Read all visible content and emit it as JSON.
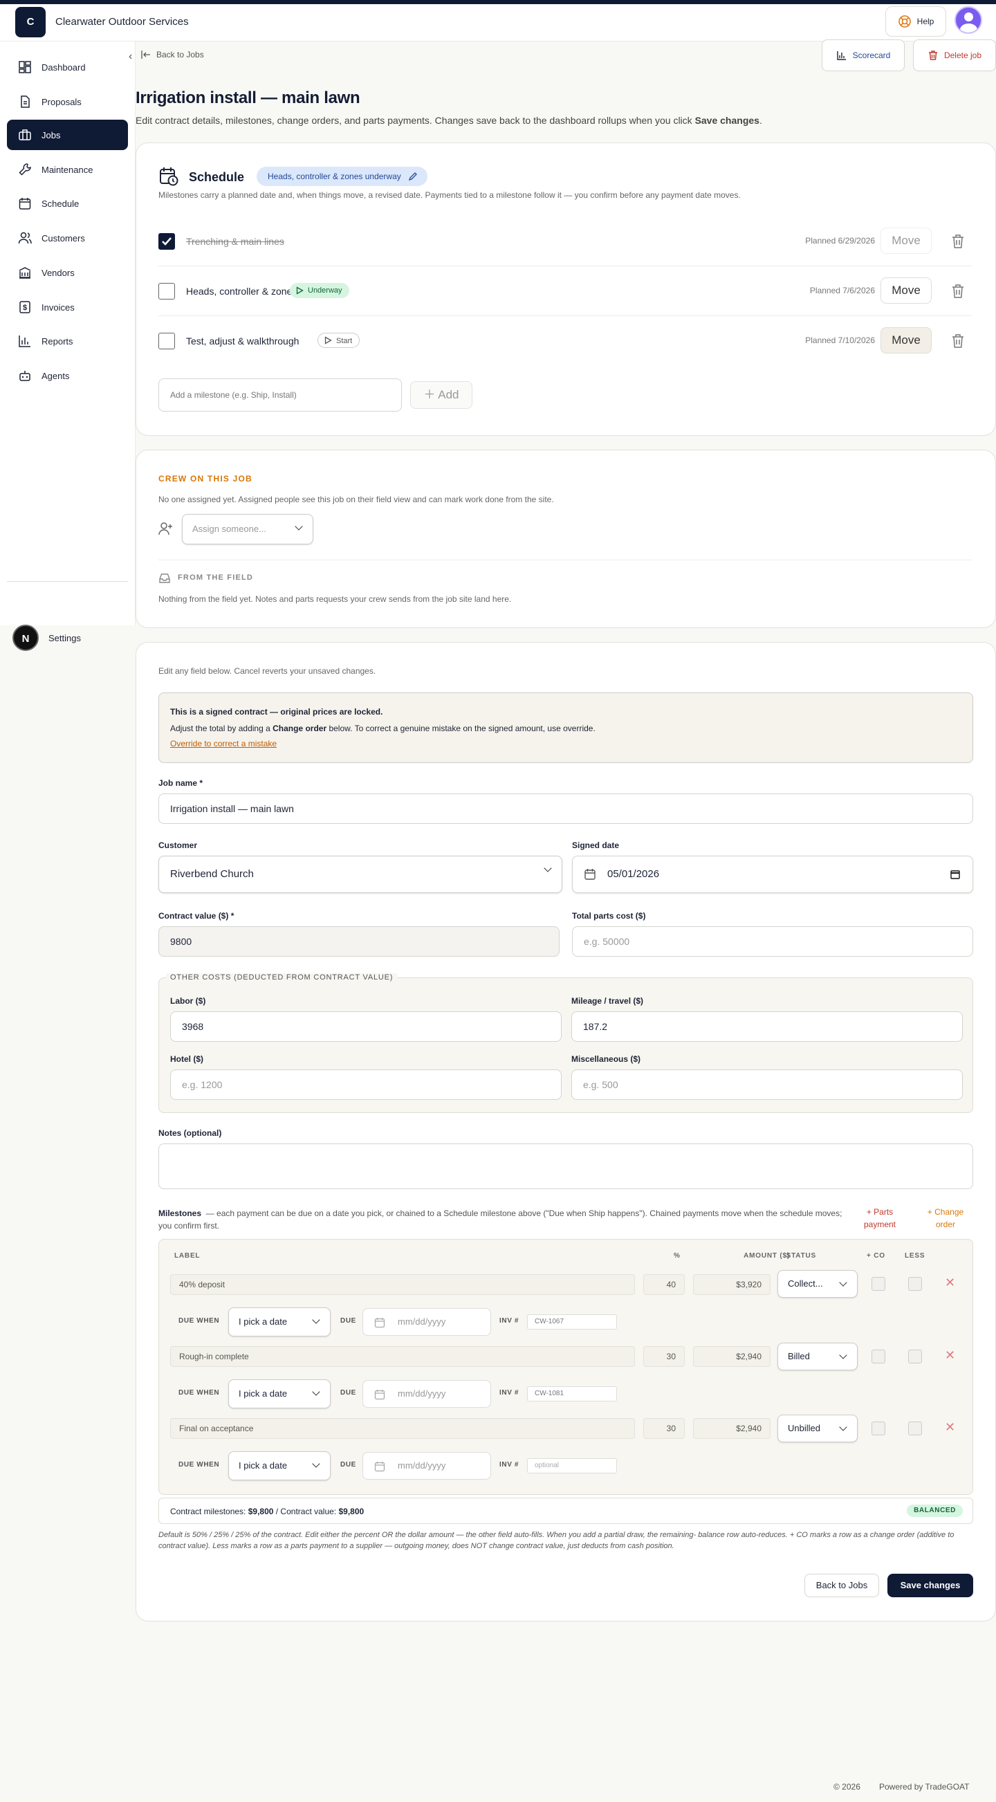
{
  "app": {
    "logo_letter": "C",
    "name": "Clearwater Outdoor Services",
    "help_label": "Help"
  },
  "sidebar": {
    "items": [
      {
        "label": "Dashboard",
        "icon": "dashboard-icon"
      },
      {
        "label": "Proposals",
        "icon": "document-icon"
      },
      {
        "label": "Jobs",
        "icon": "briefcase-icon",
        "active": true
      },
      {
        "label": "Maintenance",
        "icon": "wrench-icon"
      },
      {
        "label": "Schedule",
        "icon": "calendar-icon"
      },
      {
        "label": "Customers",
        "icon": "users-icon"
      },
      {
        "label": "Vendors",
        "icon": "building-icon"
      },
      {
        "label": "Invoices",
        "icon": "dollar-icon"
      },
      {
        "label": "Reports",
        "icon": "bar-chart-icon"
      },
      {
        "label": "Agents",
        "icon": "bot-icon"
      }
    ],
    "settings_label": "Settings",
    "user_initial": "N"
  },
  "header": {
    "back_label": "Back to Jobs",
    "scorecard_label": "Scorecard",
    "delete_label": "Delete job",
    "title": "Irrigation install — main lawn",
    "subtitle_prefix": "Edit contract details, milestones, change orders, and parts payments. Changes save back to the dashboard rollups when you click ",
    "subtitle_bold": "Save changes",
    "subtitle_suffix": "."
  },
  "schedule": {
    "title": "Schedule",
    "status_pill": "Heads, controller & zones underway",
    "description": "Milestones carry a planned date and, when things move, a revised date. Payments tied to a milestone follow it — you confirm before any payment date moves.",
    "milestones": [
      {
        "label": "Trenching & main lines",
        "done": true,
        "status": "",
        "planned": "Planned 6/29/2026",
        "move": "Move"
      },
      {
        "label": "Heads, controller & zones",
        "done": false,
        "status": "Underway",
        "planned": "Planned 7/6/2026",
        "move": "Move"
      },
      {
        "label": "Test, adjust & walkthrough",
        "done": false,
        "status": "Start",
        "planned": "Planned 7/10/2026",
        "move": "Move"
      }
    ],
    "add_placeholder": "Add a milestone (e.g. Ship, Install)",
    "add_label": "Add"
  },
  "crew": {
    "heading": "CREW ON THIS JOB",
    "description": "No one assigned yet. Assigned people see this job on their field view and can mark work done from the site.",
    "assign_placeholder": "Assign someone...",
    "field_heading": "FROM THE FIELD",
    "field_description": "Nothing from the field yet. Notes and parts requests your crew sends from the job site land here."
  },
  "form": {
    "intro": "Edit any field below. Cancel reverts your unsaved changes.",
    "notice_title": "This is a signed contract — original prices are locked.",
    "notice_text_a": "Adjust the total by adding a ",
    "notice_text_bold": "Change order",
    "notice_text_b": " below. To correct a genuine mistake on the signed amount, use override.",
    "notice_link": "Override to correct a mistake",
    "job_name_label": "Job name *",
    "job_name": "Irrigation install — main lawn",
    "customer_label": "Customer",
    "customer": "Riverbend Church",
    "signed_label": "Signed date",
    "signed_date": "05/01/2026",
    "contract_label": "Contract value ($) *",
    "contract_value": "9800",
    "parts_label": "Total parts cost ($)",
    "parts_placeholder": "e.g. 50000",
    "other_costs_legend": "OTHER COSTS (DEDUCTED FROM CONTRACT VALUE)",
    "labor_label": "Labor ($)",
    "labor": "3968",
    "mileage_label": "Mileage / travel ($)",
    "mileage": "187.2",
    "hotel_label": "Hotel ($)",
    "hotel_placeholder": "e.g. 1200",
    "misc_label": "Miscellaneous ($)",
    "misc_placeholder": "e.g. 500",
    "notes_label": "Notes (optional)"
  },
  "payments": {
    "title": "Milestones",
    "description": "— each payment can be due on a date you pick, or chained to a Schedule milestone above (\"Due when Ship happens\"). Chained payments move when the schedule moves; you confirm first.",
    "add_parts": "+ Parts payment",
    "add_co": "+ Change order",
    "headers": {
      "label": "LABEL",
      "pct": "%",
      "amount": "AMOUNT ($)",
      "status": "STATUS",
      "co": "+ CO",
      "less": "LESS"
    },
    "due_when_label": "DUE WHEN",
    "due_label": "DUE",
    "inv_label": "INV #",
    "rows": [
      {
        "label": "40% deposit",
        "pct": "40",
        "amount": "$3,920",
        "status": "Collect...",
        "due_when": "I pick a date",
        "due_placeholder": "mm/dd/yyyy",
        "inv": "CW-1067"
      },
      {
        "label": "Rough-in complete",
        "pct": "30",
        "amount": "$2,940",
        "status": "Billed",
        "due_when": "I pick a date",
        "due_placeholder": "mm/dd/yyyy",
        "inv": "CW-1081"
      },
      {
        "label": "Final on acceptance",
        "pct": "30",
        "amount": "$2,940",
        "status": "Unbilled",
        "due_when": "I pick a date",
        "due_placeholder": "mm/dd/yyyy",
        "inv": "optional"
      }
    ],
    "summary_a": "Contract milestones: ",
    "summary_milestones": "$9,800",
    "summary_b": " / Contract value: ",
    "summary_contract": "$9,800",
    "balanced": "BALANCED",
    "help_text": "Default is 50% / 25% / 25% of the contract. Edit either the percent OR the dollar amount — the other field auto-fills. When you add a partial draw, the remaining- balance row auto-reduces. + CO marks a row as a change order (additive to contract value). Less marks a row as a parts payment to a supplier — outgoing money, does NOT change contract value, just deducts from cash position."
  },
  "actions": {
    "back_label": "Back to Jobs",
    "save_label": "Save changes"
  },
  "footer": {
    "copyright": "© 2026",
    "powered": "Powered by TradeGOAT"
  },
  "colors": {
    "navy": "#0f1a35",
    "accent_orange": "#d97706",
    "danger": "#c0392b",
    "success_bg": "#d5f5e0"
  }
}
